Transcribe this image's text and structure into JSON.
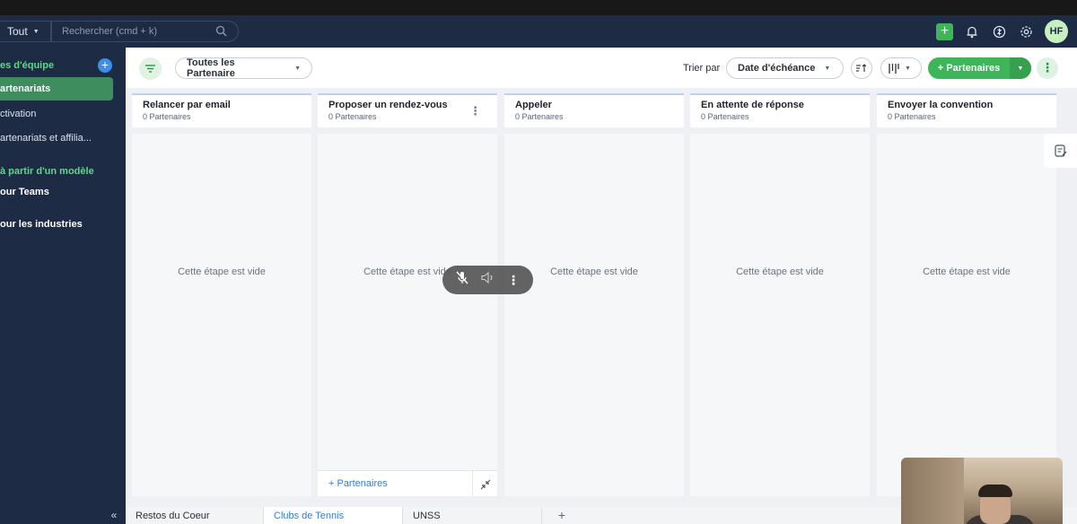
{
  "topbar": {
    "scope_label": "Tout",
    "search_placeholder": "Rechercher (cmd + k)",
    "avatar_initials": "HF",
    "accent_color": "#3fb55a"
  },
  "sidebar": {
    "section_title": "es d'équipe",
    "items": [
      {
        "label": "artenariats",
        "active": true
      },
      {
        "label": "ctivation"
      },
      {
        "label": "artenariats et affilia..."
      }
    ],
    "template_heading": "à partir d'un modèle",
    "template_items": [
      {
        "label": "our Teams"
      },
      {
        "label": "our les industries"
      }
    ],
    "collapse_glyph": "«"
  },
  "toolbar": {
    "view_select": "Toutes les Partenaire",
    "sort_label": "Trier par",
    "sort_value": "Date d'échéance",
    "add_button": "+ Partenaires"
  },
  "columns": [
    {
      "title": "Relancer par email",
      "count": "0 Partenaires",
      "empty": "Cette étape est vide"
    },
    {
      "title": "Proposer un rendez-vous",
      "count": "0 Partenaires",
      "empty": "Cette étape est vide",
      "footer_add": "+ Partenaires"
    },
    {
      "title": "Appeler",
      "count": "0 Partenaires",
      "empty": "Cette étape est vide"
    },
    {
      "title": "En attente de réponse",
      "count": "0 Partenaires",
      "empty": "Cette étape est vide"
    },
    {
      "title": "Envoyer la convention",
      "count": "0 Partenaires",
      "empty": "Cette étape est vide"
    }
  ],
  "tabs": [
    {
      "label": "Restos du Coeur"
    },
    {
      "label": "Clubs de Tennis",
      "active": true
    },
    {
      "label": "UNSS"
    }
  ],
  "tab_add": "+"
}
